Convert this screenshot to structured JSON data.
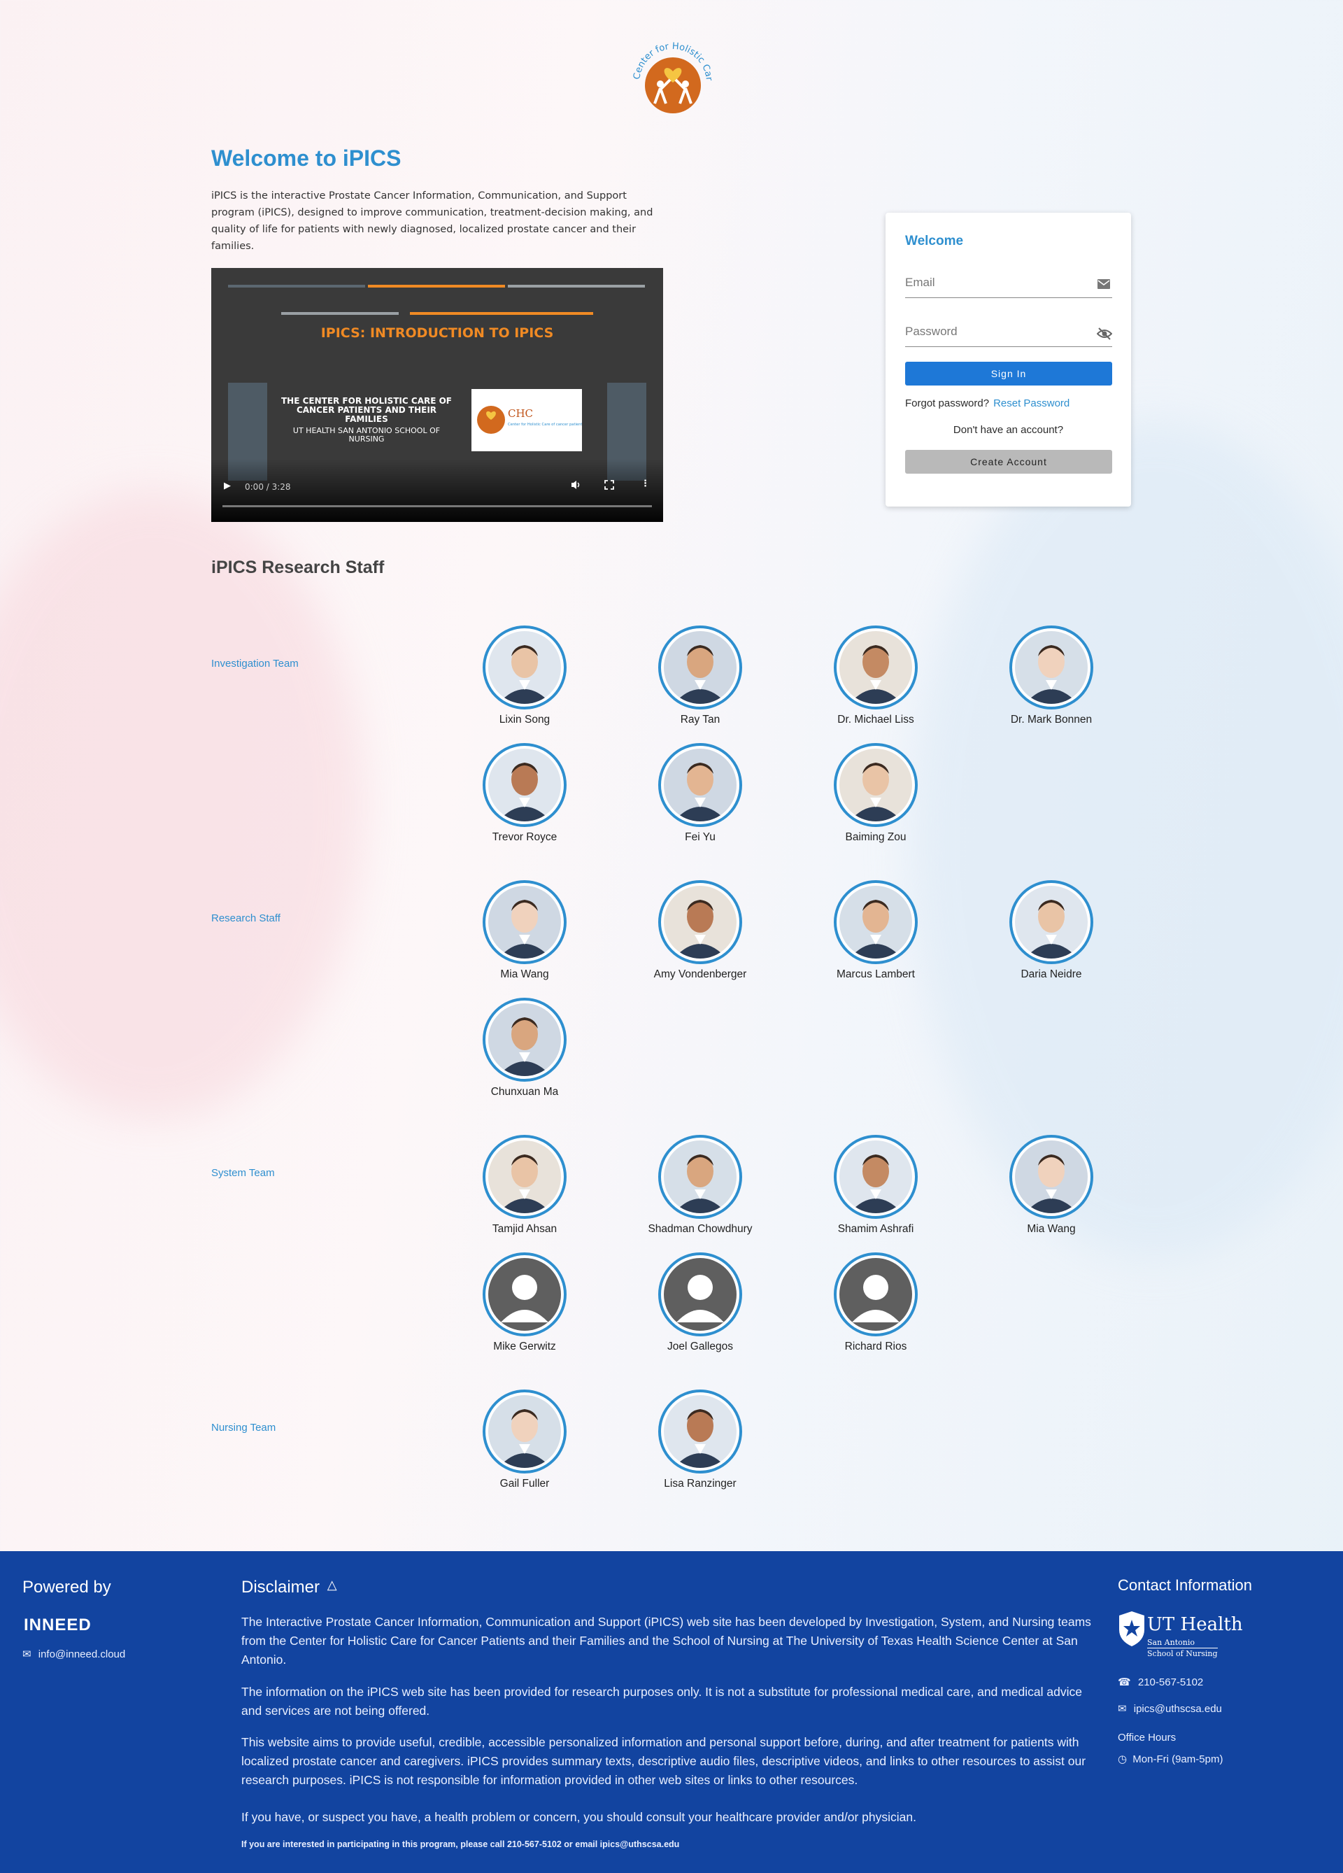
{
  "logo": {
    "arc_text": "Center for Holistic Care"
  },
  "intro": {
    "title": "Welcome to iPICS",
    "text": "iPICS is the interactive Prostate Cancer Information, Communication, and Support program (iPICS), designed to improve communication, treatment-decision making, and quality of life for patients with newly diagnosed, localized prostate cancer and their families."
  },
  "video": {
    "slide_title": "IPICS: INTRODUCTION TO IPICS",
    "org_name": "THE CENTER FOR HOLISTIC CARE OF CANCER PATIENTS AND THEIR FAMILIES",
    "school": "UT HEALTH SAN ANTONIO SCHOOL OF NURSING",
    "chc_abbr": "CHC",
    "chc_line": "Center for Holistic Care of cancer patients and their families",
    "time": "0:00 / 3:28",
    "progress": 0
  },
  "login": {
    "title": "Welcome",
    "email_placeholder": "Email",
    "password_placeholder": "Password",
    "signin_label": "Sign In",
    "forgot_text": "Forgot password?",
    "reset_link": "Reset Password",
    "no_account_text": "Don't have an account?",
    "create_label": "Create Account"
  },
  "staff": {
    "title": "iPICS Research Staff",
    "teams": [
      {
        "label": "Investigation Team",
        "people": [
          "Lixin Song",
          "Ray Tan",
          "Dr. Michael Liss",
          "Dr. Mark Bonnen",
          "Trevor Royce",
          "Fei Yu",
          "Baiming Zou"
        ]
      },
      {
        "label": "Research Staff",
        "people": [
          "Mia Wang",
          "Amy Vondenberger",
          "Marcus Lambert",
          "Daria Neidre",
          "Chunxuan Ma"
        ]
      },
      {
        "label": "System Team",
        "people": [
          "Tamjid Ahsan",
          "Shadman Chowdhury",
          "Shamim Ashrafi",
          "Mia Wang",
          "Mike Gerwitz",
          "Joel Gallegos",
          "Richard Rios"
        ]
      },
      {
        "label": "Nursing Team",
        "people": [
          "Gail Fuller",
          "Lisa Ranzinger"
        ]
      }
    ]
  },
  "footer": {
    "powered_by": "Powered by",
    "inneed_logo": "INNEED",
    "inneed_email": "info@inneed.cloud",
    "disclaimer_title": "Disclaimer",
    "paragraphs": [
      "The Interactive Prostate Cancer Information, Communication and Support (iPICS) web site has been developed by Investigation, System, and Nursing teams from the Center for Holistic Care for Cancer Patients and their Families and the School of Nursing at The University of Texas Health Science Center at San Antonio.",
      "The information on the iPICS web site has been provided for research purposes only. It is not a substitute for professional medical care, and medical advice and services are not being offered.",
      "This website aims to provide useful, credible, accessible personalized information and personal support before, during, and after treatment for patients with localized prostate cancer and caregivers. iPICS provides summary texts, descriptive audio files, descriptive videos, and links to other resources to assist our research purposes. iPICS is not responsible for information provided in other web sites or links to other resources.",
      "If you have, or suspect you have, a health problem or concern, you should consult your healthcare provider and/or physician."
    ],
    "contact_note": "If you are interested in participating in this program, please call 210-567-5102 or email ipics@uthscsa.edu",
    "contact_title": "Contact Information",
    "ut_health": "UT Health",
    "ut_sub1": "San Antonio",
    "ut_sub2": "School of Nursing",
    "phone": "210-567-5102",
    "email": "ipics@uthscsa.edu",
    "office_hours_label": "Office Hours",
    "office_hours": "Mon-Fri (9am-5pm)"
  },
  "colors": {
    "accent": "#2e8fcf",
    "footer": "#1244a0",
    "signin": "#1e78d7",
    "logo_orange": "#d2691e"
  }
}
